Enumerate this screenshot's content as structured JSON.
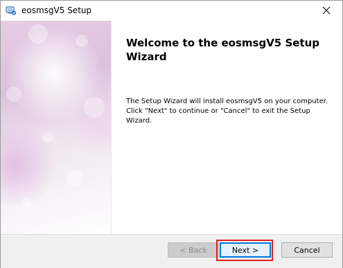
{
  "window": {
    "title": "eosmsgV5 Setup",
    "app_icon": "installer-icon",
    "close_icon": "close-icon"
  },
  "main": {
    "heading": "Welcome to the eosmsgV5 Setup Wizard",
    "body_line1": "The Setup Wizard will install eosmsgV5 on your computer.",
    "body_line2": "Click \"Next\" to continue or \"Cancel\" to exit the Setup Wizard."
  },
  "footer": {
    "back_label": "< Back",
    "next_label": "Next >",
    "cancel_label": "Cancel",
    "back_enabled": false,
    "highlight_color": "#e0201a"
  },
  "colors": {
    "accent": "#0078d7",
    "side_panel": "#dcc1dc"
  }
}
